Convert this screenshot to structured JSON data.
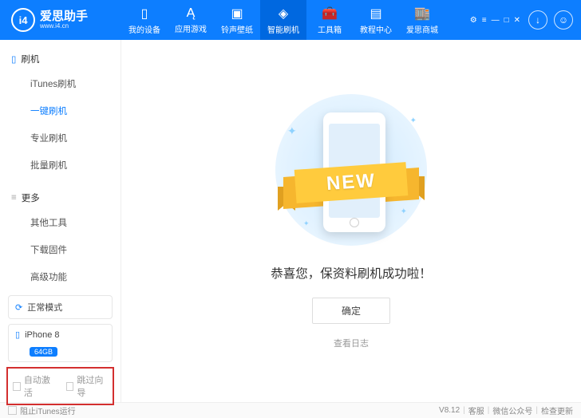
{
  "brand": {
    "logo_text": "i4",
    "name": "爱思助手",
    "url": "www.i4.cn"
  },
  "nav": {
    "items": [
      {
        "label": "我的设备"
      },
      {
        "label": "应用游戏"
      },
      {
        "label": "铃声壁纸"
      },
      {
        "label": "智能刷机"
      },
      {
        "label": "工具箱"
      },
      {
        "label": "教程中心"
      },
      {
        "label": "爱思商城"
      }
    ]
  },
  "sidebar": {
    "section1": {
      "title": "刷机"
    },
    "items1": [
      {
        "label": "iTunes刷机"
      },
      {
        "label": "一键刷机"
      },
      {
        "label": "专业刷机"
      },
      {
        "label": "批量刷机"
      }
    ],
    "section2": {
      "title": "更多"
    },
    "items2": [
      {
        "label": "其他工具"
      },
      {
        "label": "下载固件"
      },
      {
        "label": "高级功能"
      }
    ],
    "mode_label": "正常模式",
    "device_name": "iPhone 8",
    "device_capacity": "64GB",
    "opt_auto_activate": "自动激活",
    "opt_skip_setup": "跳过向导"
  },
  "main": {
    "ribbon_text": "NEW",
    "success_text": "恭喜您，保资料刷机成功啦！",
    "ok_button": "确定",
    "view_log": "查看日志"
  },
  "footer": {
    "block_itunes": "阻止iTunes运行",
    "version": "V8.12",
    "support": "客服",
    "wechat": "微信公众号",
    "check_update": "检查更新"
  }
}
